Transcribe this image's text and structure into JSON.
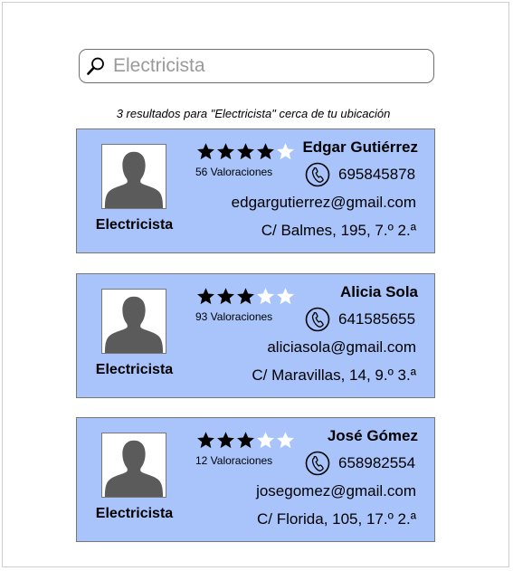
{
  "search": {
    "value": "Electricista",
    "icon": "magnifier-icon"
  },
  "results_summary": "3 resultados para \"Electricista\" cerca de tu ubicación",
  "colors": {
    "card_background": "#a8c4fb",
    "star_filled": "#000000",
    "star_empty": "#ffffff",
    "avatar_silhouette": "#5b5b5b"
  },
  "results": [
    {
      "role": "Electricista",
      "name": "Edgar Gutiérrez",
      "rating": 4,
      "max_rating": 5,
      "ratings_count": "56 Valoraciones",
      "phone": "695845878",
      "email": "edgargutierrez@gmail.com",
      "address": "C/ Balmes, 195, 7.º 2.ª"
    },
    {
      "role": "Electricista",
      "name": "Alicia Sola",
      "rating": 3,
      "max_rating": 5,
      "ratings_count": "93 Valoraciones",
      "phone": "641585655",
      "email": "aliciasola@gmail.com",
      "address": "C/ Maravillas, 14, 9.º 3.ª"
    },
    {
      "role": "Electricista",
      "name": "José Gómez",
      "rating": 3,
      "max_rating": 5,
      "ratings_count": "12 Valoraciones",
      "phone": "658982554",
      "email": "josegomez@gmail.com",
      "address": "C/ Florida, 105, 17.º 2.ª"
    }
  ]
}
